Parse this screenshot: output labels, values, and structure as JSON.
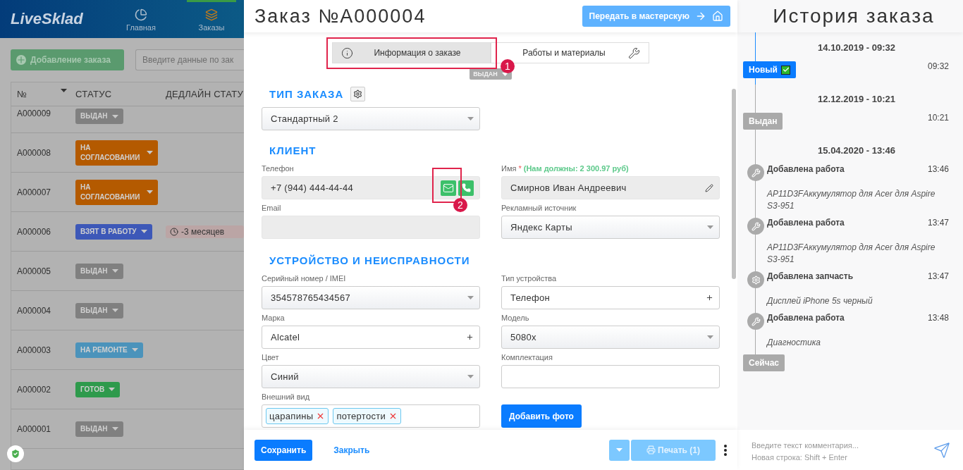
{
  "background": {
    "logo": "LiveSklad",
    "nav": [
      {
        "label": "Главная",
        "selected": false
      },
      {
        "label": "Заказы",
        "selected": true
      }
    ],
    "add_button": "Добавление заказа",
    "search": {
      "placeholder": "Введите данные по зак"
    },
    "table": {
      "columns": [
        "№",
        "СТАТУС",
        "ДЕДЛАЙН СТАТУ"
      ],
      "rows": [
        {
          "number": "A000009",
          "status": "ВЫДАН",
          "color": "#808080"
        },
        {
          "number": "A000008",
          "status": "НА СОГЛАСОВАНИИ",
          "color": "#b45a00"
        },
        {
          "number": "A000007",
          "status": "НА СОГЛАСОВАНИИ",
          "color": "#b45a00"
        },
        {
          "number": "A000006",
          "status": "ВЗЯТ В РАБОТУ",
          "color": "#3d58b8",
          "deadline": "-3 месяцев"
        },
        {
          "number": "A000005",
          "status": "ВЫДАН",
          "color": "#808080"
        },
        {
          "number": "A000004",
          "status": "ВЫДАН",
          "color": "#808080"
        },
        {
          "number": "A000003",
          "status": "НА РЕМОНТЕ",
          "color": "#4b93bb"
        },
        {
          "number": "A000002",
          "status": "ГОТОВ",
          "color": "#2e9a4c"
        },
        {
          "number": "A000001",
          "status": "ВЫДАН",
          "color": "#808080"
        }
      ]
    }
  },
  "order": {
    "title": "Заказ №A000004",
    "transfer_button": "Передать в мастерскую",
    "tabs": [
      {
        "label": "Информация о заказе",
        "selected": true
      },
      {
        "label": "Работы и материалы",
        "selected": false
      }
    ],
    "status": "ВЫДАН",
    "order_type": {
      "heading": "ТИП ЗАКАЗА",
      "value": "Стандартный 2"
    },
    "client": {
      "heading": "КЛИЕНТ",
      "fields": [
        {
          "kind": "phone",
          "label": "Телефон",
          "value": "+7 (944) 444-44-44"
        },
        {
          "kind": "name",
          "label": "Имя",
          "required_mark": "*",
          "note": "(Нам должны: 2 300.97 руб)",
          "value": "Смирнов Иван Андреевич"
        },
        {
          "kind": "readonly",
          "label": "Email"
        },
        {
          "kind": "select",
          "label": "Рекламный источник",
          "value": "Яндекс Карты"
        }
      ]
    },
    "device": {
      "heading": "УСТРОЙСТВО И НЕИСПРАВНОСТИ",
      "fields": [
        {
          "kind": "select",
          "label": "Серийный номер / IMEI",
          "value": "354578765434567"
        },
        {
          "kind": "add",
          "label": "Тип устройства",
          "value": "Телефон"
        },
        {
          "kind": "add",
          "label": "Марка",
          "value": "Alcatel"
        },
        {
          "kind": "select",
          "label": "Модель",
          "value": "5080x"
        },
        {
          "kind": "select",
          "label": "Цвет",
          "value": "Синий"
        },
        {
          "kind": "text",
          "label": "Комплектация"
        },
        {
          "kind": "tags",
          "label": "Внешний вид",
          "tags": [
            "царапины",
            "потертости"
          ]
        },
        {
          "kind": "button",
          "label": "Добавить фото"
        }
      ]
    },
    "footer": {
      "save": "Сохранить",
      "close": "Закрыть",
      "print": "Печать (1)",
      "print_disabled": true
    },
    "annotations": [
      "1",
      "2"
    ]
  },
  "history": {
    "title": "История заказа",
    "items": [
      {
        "kind": "date",
        "text": "14.10.2019 - 09:32"
      },
      {
        "kind": "status",
        "text": "Новый",
        "color": "#0a7cff",
        "checked": true,
        "time": "09:32"
      },
      {
        "kind": "date",
        "text": "12.12.2019 - 10:21"
      },
      {
        "kind": "status",
        "text": "Выдан",
        "color": "#aaaaaa",
        "checked": false,
        "time": "10:21"
      },
      {
        "kind": "date",
        "text": "15.04.2020 - 13:46"
      },
      {
        "kind": "work",
        "text": "Добавлена работа",
        "time": "13:46",
        "detail": "AP11D3FАккумулятор для Acer для Aspire S3-951"
      },
      {
        "kind": "work",
        "text": "Добавлена работа",
        "time": "13:47",
        "detail": "AP11D3FАккумулятор для Acer для Aspire S3-951"
      },
      {
        "kind": "part",
        "text": "Добавлена запчасть",
        "time": "13:47",
        "detail": "Дисплей iPhone 5s черный"
      },
      {
        "kind": "work",
        "text": "Добавлена работа",
        "time": "13:48",
        "detail": "Диагностика"
      },
      {
        "kind": "now",
        "text": "Сейчас"
      }
    ],
    "comment": {
      "placeholder": "Введите текст комментария...\nНовая строка: Shift + Enter"
    }
  }
}
